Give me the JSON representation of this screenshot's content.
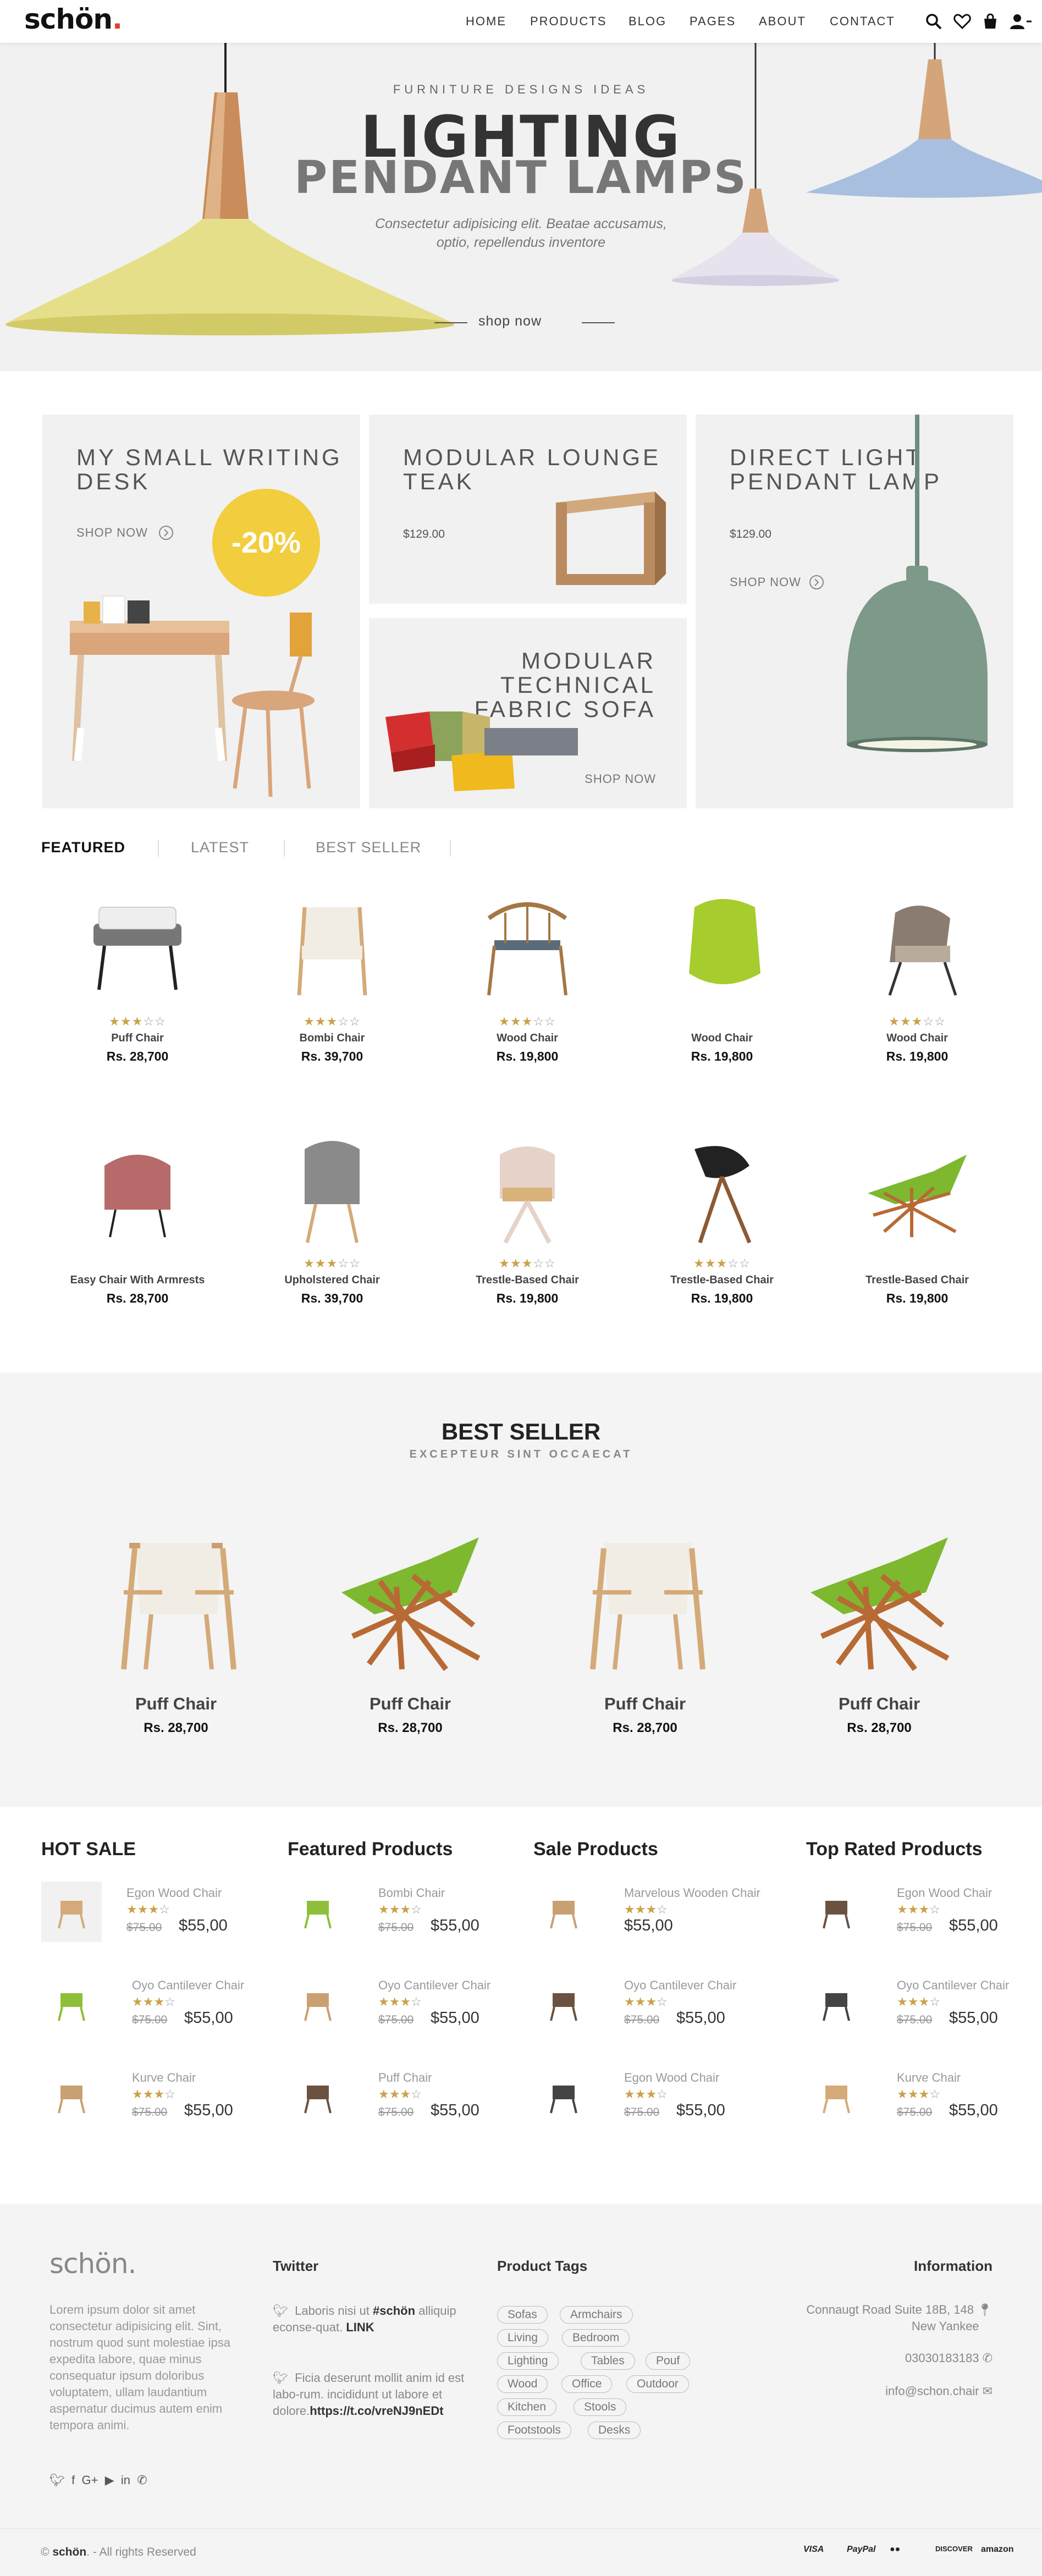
{
  "header": {
    "logo": "schön",
    "logo_dot": ".",
    "nav": [
      "HOME",
      "PRODUCTS",
      "BLOG",
      "PAGES",
      "ABOUT",
      "CONTACT"
    ],
    "icons": [
      "search-icon",
      "heart-icon",
      "bag-icon",
      "user-icon"
    ]
  },
  "hero": {
    "subtitle": "FURNITURE DESIGNS IDEAS",
    "title_line1": "LIGHTING",
    "title_line2": "PENDANT LAMPS",
    "desc_line1": "Consectetur adipisicing elit. Beatae accusamus,",
    "desc_line2": "optio, repellendus inventore",
    "cta": "shop now"
  },
  "categories": {
    "desk": {
      "title_line1": "MY SMALL WRITING",
      "title_line2": "DESK",
      "link": "SHOP NOW",
      "badge": "-20%"
    },
    "lounge": {
      "title_line1": "MODULAR LOUNGE",
      "title_line2": "TEAK",
      "price": "$129.00"
    },
    "sofa": {
      "title_line1": "MODULAR TECHNICAL",
      "title_line2": "FABRIC SOFA",
      "link": "SHOP NOW"
    },
    "lamp": {
      "title_line1": "DIRECT LIGHT",
      "title_line2": "PENDANT LAMP",
      "price": "$129.00",
      "link": "SHOP NOW"
    }
  },
  "tabs": [
    "FEATURED",
    "LATEST",
    "BEST SELLER"
  ],
  "products": [
    {
      "name": "Puff Chair",
      "price": "Rs. 28,700",
      "stars": 3
    },
    {
      "name": "Bombi Chair",
      "price": "Rs. 39,700",
      "stars": 3
    },
    {
      "name": "Wood Chair",
      "price": "Rs. 19,800",
      "stars": 3
    },
    {
      "name": "Wood Chair",
      "price": "Rs. 19,800",
      "stars": 0
    },
    {
      "name": "Wood Chair",
      "price": "Rs. 19,800",
      "stars": 3
    },
    {
      "name": "Easy Chair With Armrests",
      "price": "Rs. 28,700",
      "stars": 0
    },
    {
      "name": "Upholstered Chair",
      "price": "Rs. 39,700",
      "stars": 3
    },
    {
      "name": "Trestle-Based Chair",
      "price": "Rs. 19,800",
      "stars": 3
    },
    {
      "name": "Trestle-Based Chair",
      "price": "Rs. 19,800",
      "stars": 3
    },
    {
      "name": "Trestle-Based Chair",
      "price": "Rs. 19,800",
      "stars": 0
    }
  ],
  "best_seller": {
    "title": "BEST SELLER",
    "subtitle": "EXCEPTEUR SINT OCCAECAT",
    "items": [
      {
        "name": "Puff Chair",
        "price": "Rs. 28,700"
      },
      {
        "name": "Puff Chair",
        "price": "Rs. 28,700"
      },
      {
        "name": "Puff Chair",
        "price": "Rs. 28,700"
      },
      {
        "name": "Puff Chair",
        "price": "Rs. 28,700"
      }
    ]
  },
  "lists": [
    {
      "title": "HOT SALE",
      "items": [
        {
          "name": "Egon Wood Chair",
          "old": "$75.00",
          "new": "$55,00"
        },
        {
          "name": "Oyo Cantilever Chair",
          "old": "$75.00",
          "new": "$55,00"
        },
        {
          "name": "Kurve Chair",
          "old": "$75.00",
          "new": "$55,00"
        }
      ]
    },
    {
      "title": "Featured Products",
      "items": [
        {
          "name": "Bombi Chair",
          "old": "$75.00",
          "new": "$55,00"
        },
        {
          "name": "Oyo Cantilever Chair",
          "old": "$75.00",
          "new": "$55,00"
        },
        {
          "name": "Puff Chair",
          "old": "$75.00",
          "new": "$55,00"
        }
      ]
    },
    {
      "title": "Sale Products",
      "items": [
        {
          "name": "Marvelous Wooden Chair",
          "old": "",
          "new": "$55,00"
        },
        {
          "name": "Oyo Cantilever Chair",
          "old": "$75.00",
          "new": "$55,00"
        },
        {
          "name": "Egon Wood Chair",
          "old": "$75.00",
          "new": "$55,00"
        }
      ]
    },
    {
      "title": "Top Rated Products",
      "items": [
        {
          "name": "Egon Wood Chair",
          "old": "$75.00",
          "new": "$55,00"
        },
        {
          "name": "Oyo Cantilever Chair",
          "old": "$75.00",
          "new": "$55,00"
        },
        {
          "name": "Kurve Chair",
          "old": "$75.00",
          "new": "$55,00"
        }
      ]
    }
  ],
  "footer": {
    "logo": "schön.",
    "about": "Lorem ipsum dolor sit amet consectetur adipisicing elit. Sint, nostrum quod sunt molestiae ipsa expedita labore, quae minus consequatur ipsum doloribus voluptatem, ullam laudantium aspernatur ducimus autem enim tempora animi.",
    "twitter_title": "Twitter",
    "tweet1_a": "Laboris nisi ut ",
    "tweet1_b": "#schön",
    "tweet1_c": " alliquip econse-quat. ",
    "tweet1_d": "LINK",
    "tweet2_a": "Ficia deserunt mollit anim id est labo-rum. incididunt ut labore et dolore.",
    "tweet2_b": "https://t.co/vreNJ9nEDt",
    "tags_title": "Product Tags",
    "tags": [
      "Sofas",
      "Armchairs",
      "Living",
      "Bedroom",
      "Lighting",
      "Tables",
      "Pouf",
      "Wood",
      "Office",
      "Outdoor",
      "Kitchen",
      "Stools",
      "Footstools",
      "Desks"
    ],
    "info_title": "Information",
    "address_line1": "Connaugt Road Suite 18B, 148",
    "address_line2": "New Yankee",
    "phone": "03030183183",
    "email": "info@schon.chair",
    "copyright_sym": "©",
    "copyright_brand": "schön",
    "copyright_rest": ". - All rights Reserved",
    "payments": [
      "VISA",
      "PayPal",
      "mastercard",
      "DISCOVER",
      "amazon"
    ]
  }
}
